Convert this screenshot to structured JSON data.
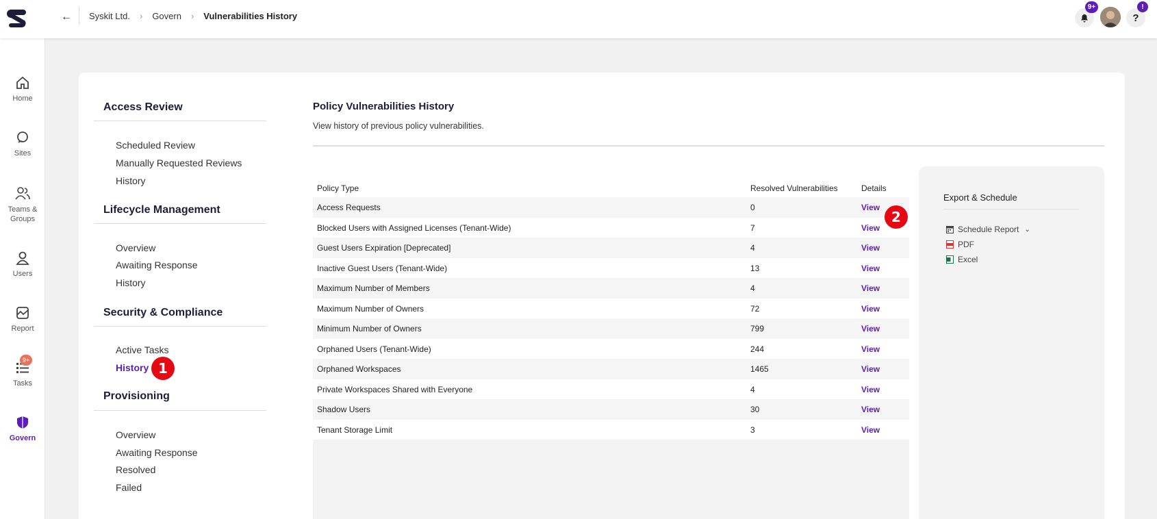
{
  "breadcrumb": {
    "items": [
      "Syskit Ltd.",
      "Govern"
    ],
    "current": "Vulnerabilities History"
  },
  "header": {
    "notifications_badge": "9+",
    "help_label": "?",
    "help_badge": "!"
  },
  "leftnav": {
    "items": [
      {
        "label": "Home",
        "icon": "home-icon"
      },
      {
        "label": "Sites",
        "icon": "sites-icon"
      },
      {
        "label": "Teams & Groups",
        "icon": "teams-icon"
      },
      {
        "label": "Users",
        "icon": "user-icon"
      },
      {
        "label": "Report",
        "icon": "report-icon"
      },
      {
        "label": "Tasks",
        "icon": "tasks-icon",
        "badge": "9+"
      },
      {
        "label": "Govern",
        "icon": "shield-icon",
        "active": true
      }
    ]
  },
  "subnav": {
    "sections": [
      {
        "title": "Access Review",
        "items": [
          "Scheduled Review",
          "Manually Requested Reviews",
          "History"
        ]
      },
      {
        "title": "Lifecycle Management",
        "items": [
          "Overview",
          "Awaiting Response",
          "History"
        ]
      },
      {
        "title": "Security & Compliance",
        "items": [
          "Active Tasks",
          "History"
        ],
        "active_item": "History"
      },
      {
        "title": "Provisioning",
        "items": [
          "Overview",
          "Awaiting Response",
          "Resolved",
          "Failed"
        ]
      }
    ]
  },
  "content": {
    "title": "Policy Vulnerabilities History",
    "subtitle": "View history of previous policy vulnerabilities."
  },
  "table": {
    "columns": [
      "Policy Type",
      "Resolved Vulnerabilities",
      "Details"
    ],
    "rows": [
      {
        "policy": "Access Requests",
        "resolved": "0",
        "details": "View"
      },
      {
        "policy": "Blocked Users with Assigned Licenses (Tenant-Wide)",
        "resolved": "7",
        "details": "View"
      },
      {
        "policy": "Guest Users Expiration [Deprecated]",
        "resolved": "4",
        "details": "View"
      },
      {
        "policy": "Inactive Guest Users (Tenant-Wide)",
        "resolved": "13",
        "details": "View"
      },
      {
        "policy": "Maximum Number of Members",
        "resolved": "4",
        "details": "View"
      },
      {
        "policy": "Maximum Number of Owners",
        "resolved": "72",
        "details": "View"
      },
      {
        "policy": "Minimum Number of Owners",
        "resolved": "799",
        "details": "View"
      },
      {
        "policy": "Orphaned Users (Tenant-Wide)",
        "resolved": "244",
        "details": "View"
      },
      {
        "policy": "Orphaned Workspaces",
        "resolved": "1465",
        "details": "View"
      },
      {
        "policy": "Private Workspaces Shared with Everyone",
        "resolved": "4",
        "details": "View"
      },
      {
        "policy": "Shadow Users",
        "resolved": "30",
        "details": "View"
      },
      {
        "policy": "Tenant Storage Limit",
        "resolved": "3",
        "details": "View"
      }
    ]
  },
  "export": {
    "title": "Export & Schedule",
    "schedule_label": "Schedule Report",
    "pdf_label": "PDF",
    "excel_label": "Excel"
  },
  "markers": [
    "1",
    "2"
  ],
  "colors": {
    "accent": "#5b1cb8",
    "marker": "#e50914",
    "tasks_badge": "#e8735a"
  }
}
